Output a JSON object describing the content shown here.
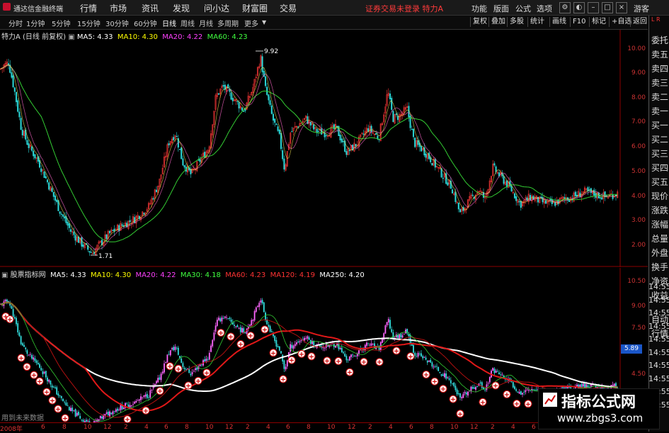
{
  "app": {
    "title": "通达信金融终端"
  },
  "menu": [
    "行情",
    "市场",
    "资讯",
    "发现",
    "问小达",
    "财富圈",
    "交易"
  ],
  "notice": "证券交易未登录 特力A",
  "right_menu": [
    "功能",
    "版面",
    "公式",
    "选项"
  ],
  "guest": "游客",
  "toolbar": {
    "periods": [
      "分时",
      "1分钟",
      "5分钟",
      "15分钟",
      "30分钟",
      "60分钟",
      "日线",
      "周线",
      "月线",
      "多周期",
      "更多"
    ],
    "active": "日线",
    "right_buttons": [
      "复权",
      "叠加",
      "多股",
      "统计",
      "画线",
      "F10",
      "标记",
      "+自选",
      "返回"
    ]
  },
  "side_panel": [
    "委托",
    "卖五",
    "卖四",
    "卖三",
    "卖二",
    "卖一",
    "买一",
    "买二",
    "买三",
    "买四",
    "买五",
    "现价",
    "涨跌",
    "涨幅",
    "总量",
    "外盘",
    "换手",
    "净资",
    "收益",
    "自动",
    "行情"
  ],
  "side_mark": "L R",
  "main_chart": {
    "stock": "特力A",
    "mode": "(日线 前复权)",
    "ma": [
      {
        "label": "MA5:",
        "value": "4.33",
        "color": "#ffffff"
      },
      {
        "label": "MA10:",
        "value": "4.30",
        "color": "#ffff00"
      },
      {
        "label": "MA20:",
        "value": "4.22",
        "color": "#ff40ff"
      },
      {
        "label": "MA60:",
        "value": "4.23",
        "color": "#40ff40"
      }
    ],
    "high_label": "9.92",
    "low_label": "1.71",
    "yticks": [
      "10.00",
      "9.00",
      "8.00",
      "7.00",
      "6.00",
      "5.00",
      "4.00",
      "3.00",
      "2.00"
    ]
  },
  "sub_chart": {
    "title": "股票指标网",
    "ma": [
      {
        "label": "MA5:",
        "value": "4.33",
        "color": "#ffffff"
      },
      {
        "label": "MA10:",
        "value": "4.30",
        "color": "#ffff00"
      },
      {
        "label": "MA20:",
        "value": "4.22",
        "color": "#ff40ff"
      },
      {
        "label": "MA30:",
        "value": "4.18",
        "color": "#40ff40"
      },
      {
        "label": "MA60:",
        "value": "4.23",
        "color": "#ff3333"
      },
      {
        "label": "MA120:",
        "value": "4.19",
        "color": "#ff3333"
      },
      {
        "label": "MA250:",
        "value": "4.20",
        "color": "#ffffff"
      }
    ],
    "yticks": [
      "10.50",
      "9.00",
      "7.50",
      "6.00",
      "4.50"
    ],
    "current_price": "5.89",
    "footer": "用到未来数据"
  },
  "side_ticks": [
    "14:55",
    "14:55",
    "14:55",
    "14:55",
    "14:55",
    "14:55",
    "14:55",
    "14:55",
    "14:55",
    "14:55"
  ],
  "x_axis": [
    "2008年",
    "6",
    "8",
    "10",
    "12",
    "2",
    "4",
    "6",
    "8",
    "10",
    "12",
    "2",
    "4",
    "6",
    "8",
    "10",
    "12",
    "2",
    "4",
    "6",
    "8",
    "10",
    "12",
    "2",
    "4",
    "6"
  ],
  "watermark": {
    "title": "指标公式网",
    "url": "www.zbgs3.com"
  }
}
